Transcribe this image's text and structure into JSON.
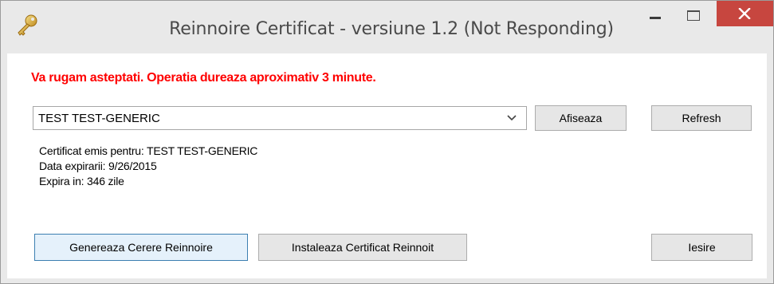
{
  "window": {
    "title": "Reinnoire Certificat - versiune 1.2 (Not Responding)",
    "icon": "key-icon",
    "accent_close": "#c7463f"
  },
  "message": {
    "warning": "Va rugam asteptati. Operatia dureaza aproximativ 3 minute.",
    "color": "#ff0000"
  },
  "certificate_select": {
    "selected": "TEST TEST-GENERIC"
  },
  "buttons": {
    "show": "Afiseaza",
    "refresh": "Refresh",
    "generate": "Genereaza Cerere Reinnoire",
    "install": "Instaleaza Certificat Reinnoit",
    "exit": "Iesire"
  },
  "info": {
    "issued_for": "Certificat emis pentru: TEST TEST-GENERIC",
    "expiry_date": "Data expirarii: 9/26/2015",
    "expires_in": "Expira in: 346 zile"
  }
}
